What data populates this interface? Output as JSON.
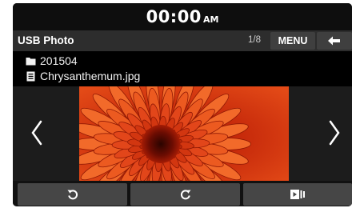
{
  "status": {
    "time": "00:00",
    "ampm": "AM"
  },
  "header": {
    "title": "USB Photo",
    "counter": "1/8",
    "menu_label": "MENU"
  },
  "file": {
    "folder": "201504",
    "filename": "Chrysanthemum.jpg"
  },
  "icons": {
    "folder": "folder-icon",
    "file": "document-icon",
    "back": "back-arrow-icon",
    "prev": "chevron-left-icon",
    "next": "chevron-right-icon",
    "rotate_left": "rotate-left-icon",
    "rotate_right": "rotate-right-icon",
    "slideshow": "slideshow-icon"
  },
  "colors": {
    "screen_bg": "#141414",
    "titlebar_bg": "#2d2d2d",
    "button_bg": "#464646",
    "photo_primary": "#e8451a"
  }
}
